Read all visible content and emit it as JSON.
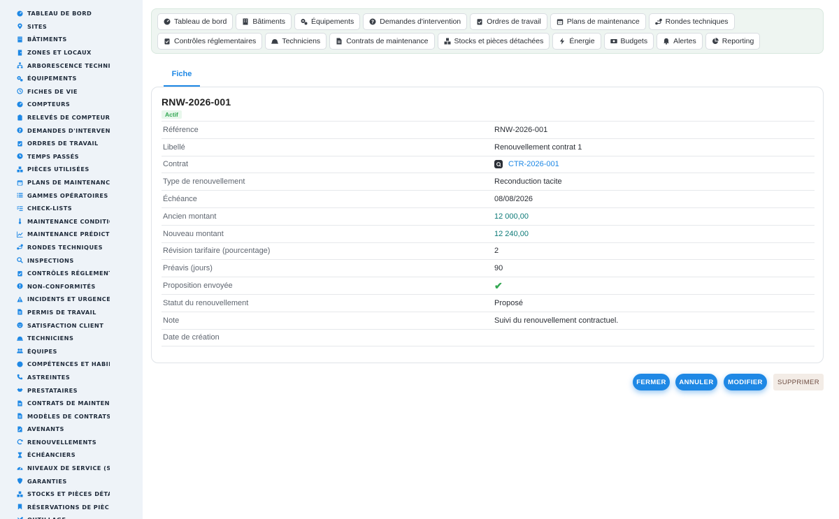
{
  "colors": {
    "accent": "#1e88e5",
    "sidebar_icon": "#1e88e5",
    "success": "#34a853",
    "money": "#0d7a78"
  },
  "sidebar": {
    "items": [
      {
        "label": "TABLEAU DE BORD",
        "icon": "gauge-icon"
      },
      {
        "label": "SITES",
        "icon": "map-pin-icon"
      },
      {
        "label": "BÂTIMENTS",
        "icon": "building-icon"
      },
      {
        "label": "ZONES ET LOCAUX",
        "icon": "door-icon"
      },
      {
        "label": "ARBORESCENCE TECHNI",
        "icon": "sitemap-icon"
      },
      {
        "label": "ÉQUIPEMENTS",
        "icon": "cogs-icon"
      },
      {
        "label": "FICHES DE VIE",
        "icon": "history-icon"
      },
      {
        "label": "COMPTEURS",
        "icon": "gauge-icon"
      },
      {
        "label": "RELEVÉS DE COMPTEURS",
        "icon": "clipboard-icon"
      },
      {
        "label": "DEMANDES D'INTERVENT",
        "icon": "question-icon"
      },
      {
        "label": "ORDRES DE TRAVAIL",
        "icon": "clipboard-check-icon"
      },
      {
        "label": "TEMPS PASSÉS",
        "icon": "clock-icon"
      },
      {
        "label": "PIÈCES UTILISÉES",
        "icon": "boxes-icon"
      },
      {
        "label": "PLANS DE MAINTENANCE",
        "icon": "calendar-icon"
      },
      {
        "label": "GAMMES OPÉRATOIRES",
        "icon": "list-icon"
      },
      {
        "label": "CHECK-LISTS",
        "icon": "checklist-icon"
      },
      {
        "label": "MAINTENANCE CONDITIO",
        "icon": "thermometer-icon"
      },
      {
        "label": "MAINTENANCE PRÉDICTI",
        "icon": "chart-line-icon"
      },
      {
        "label": "RONDES TECHNIQUES",
        "icon": "route-icon"
      },
      {
        "label": "INSPECTIONS",
        "icon": "search-icon"
      },
      {
        "label": "CONTRÔLES RÉGLEMENT",
        "icon": "clipboard-check-icon"
      },
      {
        "label": "NON-CONFORMITÉS",
        "icon": "alert-circle-icon"
      },
      {
        "label": "INCIDENTS ET URGENCES",
        "icon": "warning-icon"
      },
      {
        "label": "PERMIS DE TRAVAIL",
        "icon": "document-icon"
      },
      {
        "label": "SATISFACTION CLIENT",
        "icon": "smile-icon"
      },
      {
        "label": "TECHNICIENS",
        "icon": "hard-hat-icon"
      },
      {
        "label": "ÉQUIPES",
        "icon": "users-icon"
      },
      {
        "label": "COMPÉTENCES ET HABIL",
        "icon": "certificate-icon"
      },
      {
        "label": "ASTREINTES",
        "icon": "phone-icon"
      },
      {
        "label": "PRESTATAIRES",
        "icon": "handshake-icon"
      },
      {
        "label": "CONTRATS DE MAINTENA",
        "icon": "document-icon"
      },
      {
        "label": "MODÈLES DE CONTRATS",
        "icon": "document-icon"
      },
      {
        "label": "AVENANTS",
        "icon": "document-edit-icon"
      },
      {
        "label": "RENOUVELLEMENTS",
        "icon": "refresh-icon"
      },
      {
        "label": "ÉCHÉANCIERS",
        "icon": "hourglass-icon"
      },
      {
        "label": "NIVEAUX DE SERVICE (SL",
        "icon": "tachometer-icon"
      },
      {
        "label": "GARANTIES",
        "icon": "shield-icon"
      },
      {
        "label": "STOCKS ET PIÈCES DÉTA",
        "icon": "boxes-icon"
      },
      {
        "label": "RÉSERVATIONS DE PIÈCE",
        "icon": "bookmark-icon"
      },
      {
        "label": "OUTILLAGE",
        "icon": "tools-icon"
      }
    ]
  },
  "topnav": {
    "row1": [
      {
        "label": "Tableau de bord",
        "icon": "gauge-icon"
      },
      {
        "label": "Bâtiments",
        "icon": "building-icon"
      },
      {
        "label": "Équipements",
        "icon": "cogs-icon"
      },
      {
        "label": "Demandes d'intervention",
        "icon": "question-icon"
      },
      {
        "label": "Ordres de travail",
        "icon": "clipboard-check-icon"
      },
      {
        "label": "Plans de maintenance",
        "icon": "calendar-icon"
      },
      {
        "label": "Rondes techniques",
        "icon": "route-icon"
      }
    ],
    "row2": [
      {
        "label": "Contrôles réglementaires",
        "icon": "clipboard-check-icon"
      },
      {
        "label": "Techniciens",
        "icon": "hard-hat-icon"
      },
      {
        "label": "Contrats de maintenance",
        "icon": "document-icon"
      },
      {
        "label": "Stocks et pièces détachées",
        "icon": "boxes-icon"
      },
      {
        "label": "Énergie",
        "icon": "bolt-icon"
      },
      {
        "label": "Budgets",
        "icon": "money-icon"
      },
      {
        "label": "Alertes",
        "icon": "bell-icon"
      },
      {
        "label": "Reporting",
        "icon": "pie-chart-icon"
      }
    ]
  },
  "tabs": {
    "fiche": "Fiche"
  },
  "record": {
    "title": "RNW-2026-001",
    "status_badge": "Actif",
    "fields": [
      {
        "label": "Référence",
        "value": "RNW-2026-001",
        "kind": "text"
      },
      {
        "label": "Libellé",
        "value": "Renouvellement contrat 1",
        "kind": "text"
      },
      {
        "label": "Contrat",
        "value": "CTR-2026-001",
        "kind": "link"
      },
      {
        "label": "Type de renouvellement",
        "value": "Reconduction tacite",
        "kind": "text"
      },
      {
        "label": "Échéance",
        "value": "08/08/2026",
        "kind": "text"
      },
      {
        "label": "Ancien montant",
        "value": "12 000,00",
        "kind": "money"
      },
      {
        "label": "Nouveau montant",
        "value": "12 240,00",
        "kind": "money"
      },
      {
        "label": "Révision tarifaire (pourcentage)",
        "value": "2",
        "kind": "text"
      },
      {
        "label": "Préavis (jours)",
        "value": "90",
        "kind": "text"
      },
      {
        "label": "Proposition envoyée",
        "value": "✔",
        "kind": "check"
      },
      {
        "label": "Statut du renouvellement",
        "value": "Proposé",
        "kind": "text"
      },
      {
        "label": "Note",
        "value": "Suivi du renouvellement contractuel.",
        "kind": "text"
      },
      {
        "label": "Date de création",
        "value": "",
        "kind": "text"
      }
    ]
  },
  "actions": {
    "close": "FERMER",
    "cancel": "ANNULER",
    "edit": "MODIFIER",
    "delete": "SUPPRIMER"
  }
}
